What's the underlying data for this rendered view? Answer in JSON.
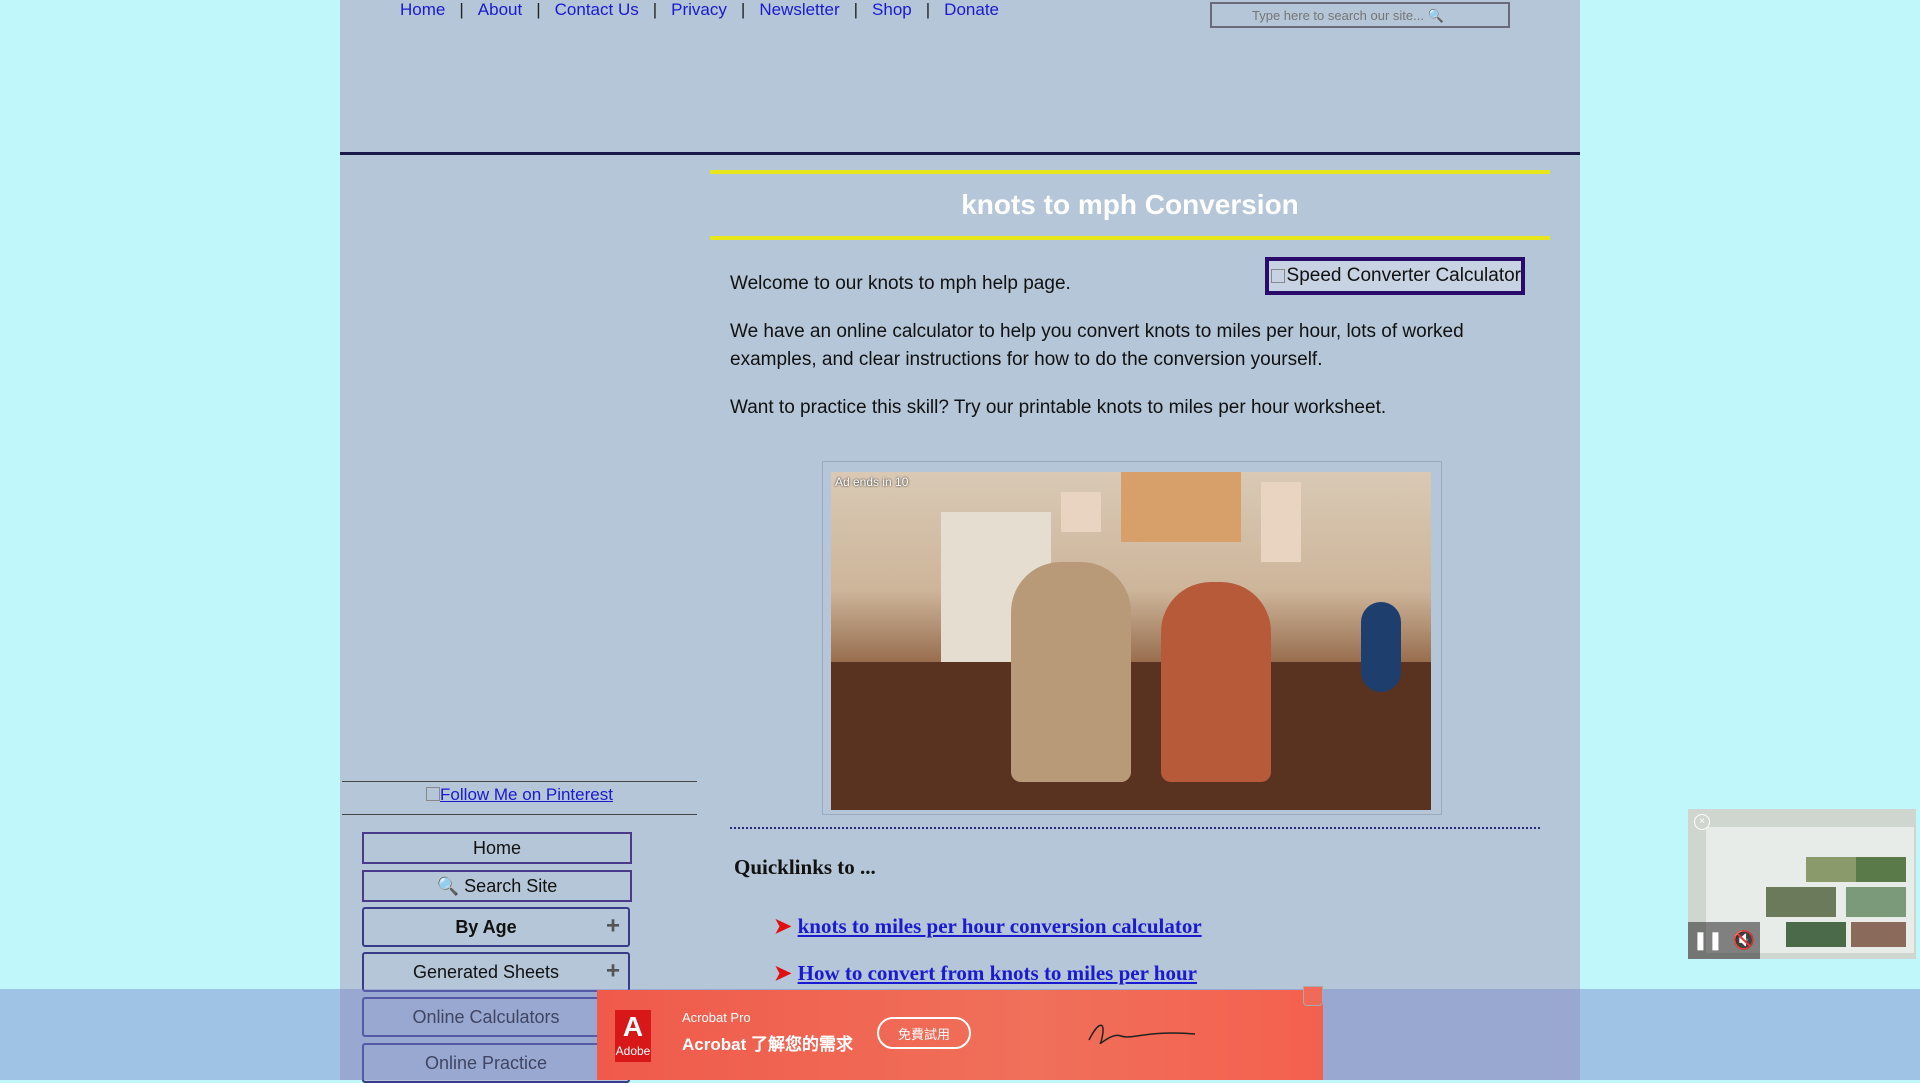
{
  "topnav": {
    "items": [
      "Home",
      "About",
      "Contact Us",
      "Privacy",
      "Newsletter",
      "Shop",
      "Donate"
    ],
    "separator": "|"
  },
  "search": {
    "placeholder": "Type here to search our site... 🔍"
  },
  "sidebar": {
    "pinterest_link": "Follow Me on Pinterest",
    "buttons": [
      {
        "label": "Home"
      },
      {
        "label": "🔍 Search Site"
      },
      {
        "label": "By Age",
        "expand": "+"
      },
      {
        "label": "Generated Sheets",
        "expand": "+"
      },
      {
        "label": "Online Calculators"
      },
      {
        "label": "Online Practice"
      }
    ]
  },
  "main": {
    "title": "knots to mph Conversion",
    "calculator_image_alt": "Speed Converter Calculator",
    "paragraphs": [
      "Welcome to our knots to mph help page.",
      "We have an online calculator to help you convert knots to miles per hour, lots of worked examples, and clear instructions for how to do the conversion yourself.",
      "Want to practice this skill? Try our printable knots to miles per hour worksheet."
    ],
    "video_ad_label": "Ad ends in 10",
    "quicklinks_title": "Quicklinks to ...",
    "quicklinks": [
      "knots to miles per hour conversion calculator",
      "How to convert from knots to miles per hour"
    ]
  },
  "bottom_ad": {
    "brand": "Adobe",
    "product": "Acrobat Pro",
    "tagline": "Acrobat 了解您的需求",
    "cta": "免費試用"
  },
  "floating_video": {
    "close_icon": "close-icon",
    "pause_icon": "pause-icon",
    "mute_icon": "mute-icon"
  }
}
